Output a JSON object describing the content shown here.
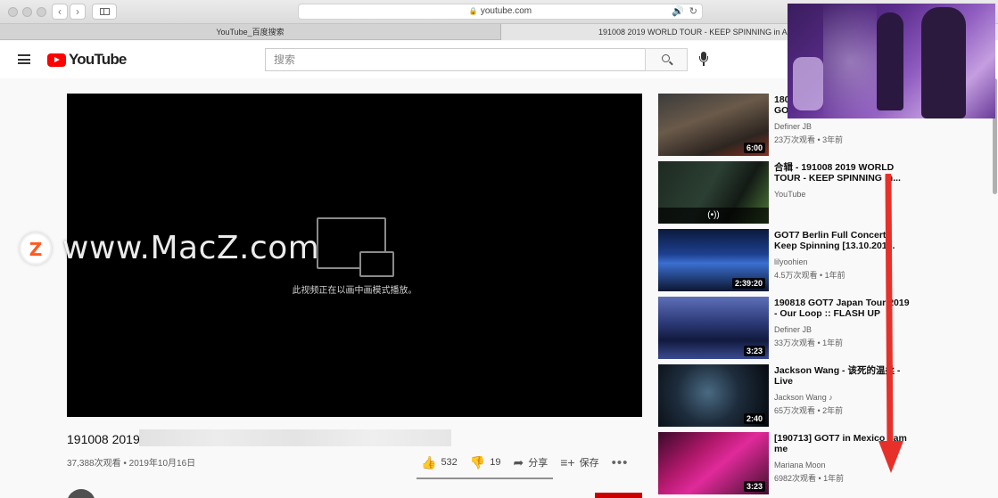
{
  "browser": {
    "url": "youtube.com",
    "tabs": [
      {
        "title": "YouTube_百度搜索",
        "active": false
      },
      {
        "title": "191008 2019 WORLD TOUR - KEEP SPINNING in AMST",
        "active": true
      }
    ]
  },
  "header": {
    "logo_text": "YouTube",
    "search_placeholder": "搜索"
  },
  "player": {
    "pip_message": "此视频正在以画中画模式播放。"
  },
  "video": {
    "title": "191008 2019",
    "views_date": "37,388次观看 • 2019年10月16日",
    "likes": "532",
    "dislikes": "19",
    "share_label": "分享",
    "save_label": "保存",
    "more_label": "•••"
  },
  "related": [
    {
      "title": "180",
      "title_line2": "GOT",
      "channel": "Definer JB",
      "meta": "23万次观看 • 3年前",
      "duration": "6:00"
    },
    {
      "title": "合辑 - 191008 2019 WORLD TOUR - KEEP SPINNING in...",
      "channel": "YouTube",
      "meta": "",
      "live_icon": "(•))"
    },
    {
      "title": "GOT7 Berlin Full Concert - Keep Spinning [13.10.201...",
      "channel": "lilyoohien",
      "meta": "4.5万次观看 • 1年前",
      "duration": "2:39:20"
    },
    {
      "title": "190818 GOT7 Japan Tour 2019 - Our Loop :: FLASH UP",
      "channel": "Definer JB",
      "meta": "33万次观看 • 1年前",
      "duration": "3:23"
    },
    {
      "title": "Jackson Wang - 该死的温柔 - Live",
      "channel": "Jackson Wang ♪",
      "meta": "65万次观看 • 2年前",
      "duration": "2:40"
    },
    {
      "title": "[190713] GOT7 in Mexico - am me",
      "channel": "Mariana Moon",
      "meta": "6982次观看 • 1年前",
      "duration": "3:23"
    }
  ],
  "watermark": {
    "logo_letter": "Z",
    "text": "www.MacZ.com"
  },
  "colors": {
    "youtube_red": "#ff0000",
    "arrow_red": "#e8302a",
    "pip_purple": "#7a46ad"
  }
}
